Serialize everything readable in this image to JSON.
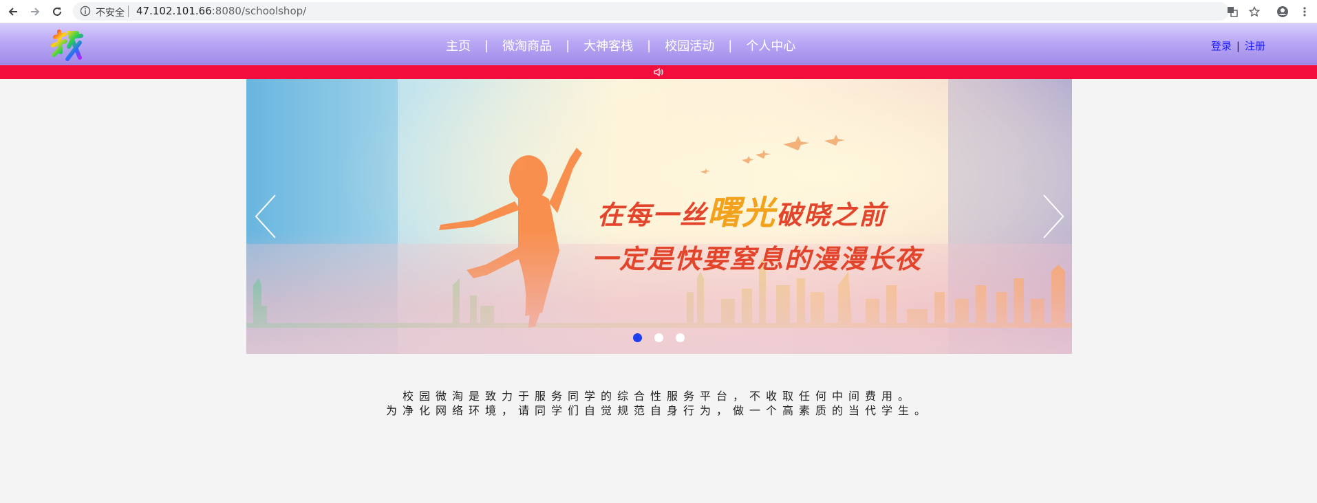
{
  "browser": {
    "security_label": "不安全",
    "url_host": "47.102.101.66",
    "url_rest": ":8080/schoolshop/"
  },
  "site": {
    "logo_char": "校",
    "nav": [
      {
        "label": "主页"
      },
      {
        "label": "微淘商品"
      },
      {
        "label": "大神客栈"
      },
      {
        "label": "校园活动"
      },
      {
        "label": "个人中心"
      }
    ],
    "nav_separator": "|",
    "auth": {
      "login": "登录",
      "separator": "|",
      "register": "注册"
    }
  },
  "banner": {
    "slogan_line1": [
      "在每一丝",
      "曙光",
      "破晓之前"
    ],
    "slogan_line2": [
      "一定是快要窒息的漫漫长夜"
    ],
    "slide_count": 3,
    "active_slide": 1
  },
  "intro": {
    "line1": "校园微淘是致力于服务同学的综合性服务平台，不收取任何中间费用。",
    "line2": "为净化网络环境，请同学们自觉规范自身行为，做一个高素质的当代学生。"
  },
  "colors": {
    "header_top": "#d7cdfc",
    "header_bottom": "#9f8ae8",
    "red_bar": "#f20d3c",
    "auth_link": "#1c1cff",
    "dot_active": "#1d3ff0"
  },
  "icons": [
    "back-icon",
    "forward-icon",
    "reload-icon",
    "info-icon",
    "translate-icon",
    "star-icon",
    "account-icon",
    "menu-icon",
    "speaker-icon",
    "chevron-left-icon",
    "chevron-right-icon"
  ]
}
